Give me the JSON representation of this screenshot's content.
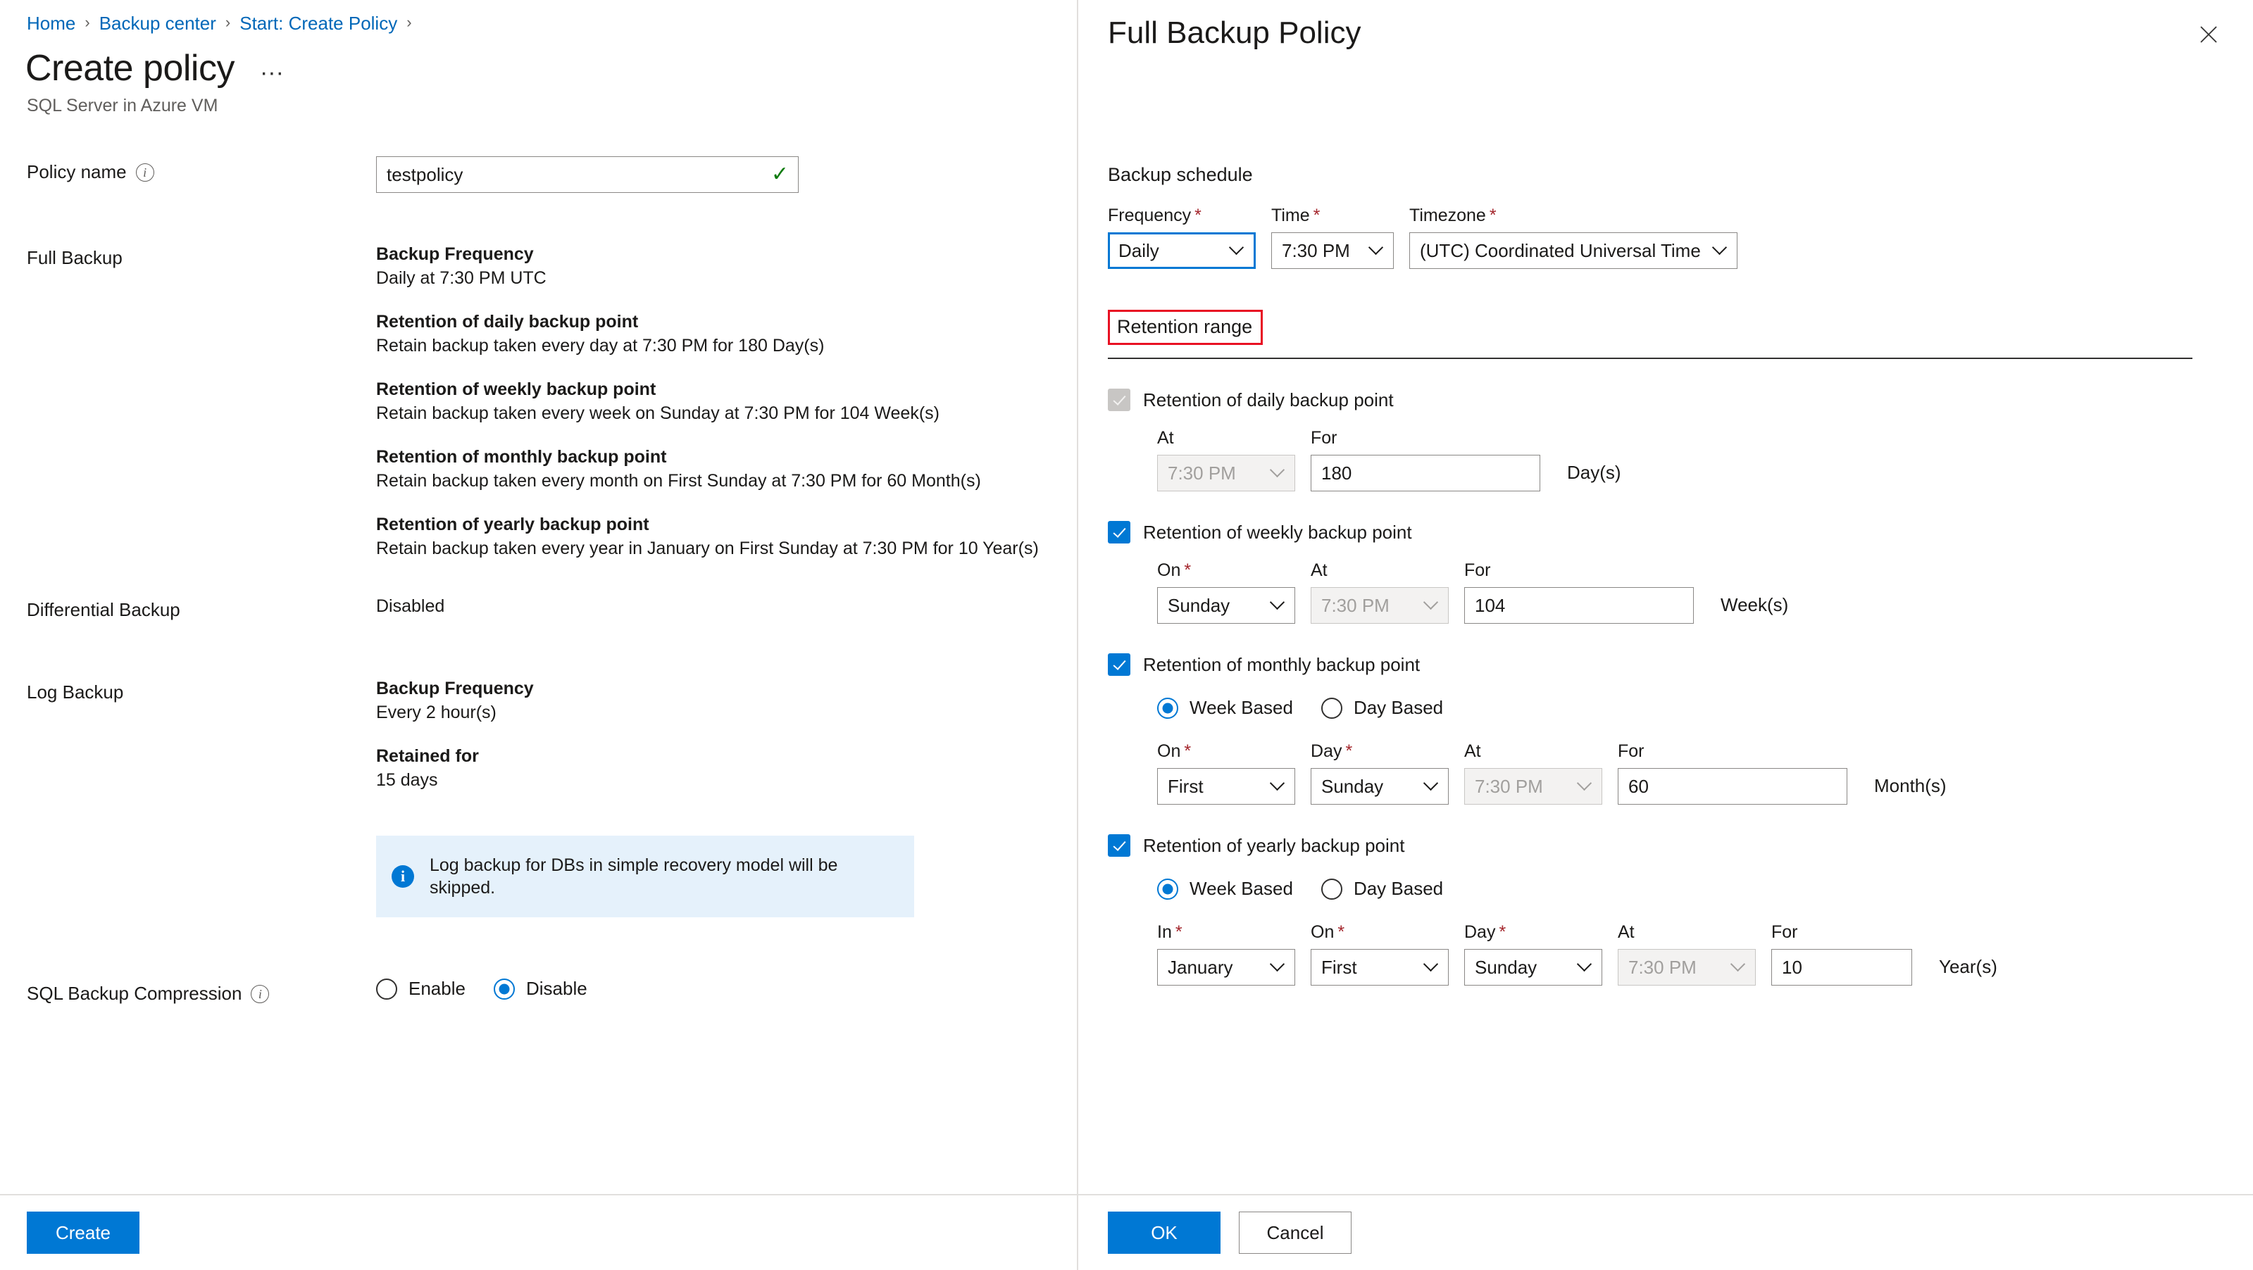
{
  "breadcrumb": {
    "items": [
      {
        "label": "Home",
        "separator": "›"
      },
      {
        "label": "Backup center",
        "separator": "›"
      },
      {
        "label": "Start: Create Policy",
        "separator": "›"
      }
    ]
  },
  "header": {
    "title": "Create policy",
    "subtitle": "SQL Server in Azure VM",
    "more_label": "···"
  },
  "left": {
    "policy_name": {
      "label": "Policy name",
      "info_glyph": "i",
      "value": "testpolicy",
      "placeholder": "",
      "valid_icon": "✓"
    },
    "full_backup": {
      "label": "Full Backup",
      "blocks": [
        {
          "head": "Backup Frequency",
          "sub": "Daily at 7:30 PM UTC"
        },
        {
          "head": "Retention of daily backup point",
          "sub": "Retain backup taken every day at 7:30 PM for 180 Day(s)"
        },
        {
          "head": "Retention of weekly backup point",
          "sub": "Retain backup taken every week on Sunday at 7:30 PM for 104 Week(s)"
        },
        {
          "head": "Retention of monthly backup point",
          "sub": "Retain backup taken every month on First Sunday at 7:30 PM for 60 Month(s)"
        },
        {
          "head": "Retention of yearly backup point",
          "sub": "Retain backup taken every year in January on First Sunday at 7:30 PM for 10 Year(s)"
        }
      ]
    },
    "differential_backup": {
      "label": "Differential Backup",
      "value": "Disabled"
    },
    "log_backup": {
      "label": "Log Backup",
      "blocks": [
        {
          "head": "Backup Frequency",
          "sub": "Every 2 hour(s)"
        },
        {
          "head": "Retained for",
          "sub": "15 days"
        }
      ],
      "banner": {
        "icon": "info-icon",
        "icon_glyph": "i",
        "text": "Log backup for DBs in simple recovery model will be skipped."
      }
    },
    "compression": {
      "label": "SQL Backup Compression",
      "info_glyph": "i",
      "options": [
        {
          "label": "Enable",
          "checked": false
        },
        {
          "label": "Disable",
          "checked": true
        }
      ]
    },
    "footer": {
      "create_label": "Create"
    }
  },
  "panel": {
    "title": "Full Backup Policy",
    "close_label": "✕",
    "backup_schedule": {
      "section_label": "Backup schedule",
      "frequency": {
        "label": "Frequency",
        "required": true,
        "value": "Daily",
        "focused": true
      },
      "time": {
        "label": "Time",
        "required": true,
        "value": "7:30 PM",
        "focused": false
      },
      "timezone": {
        "label": "Timezone",
        "required": true,
        "value": "(UTC) Coordinated Universal Time",
        "focused": false
      }
    },
    "retention_range": {
      "title": "Retention range",
      "highlight_color": "#e81123",
      "daily": {
        "checkbox_label": "Retention of daily backup point",
        "checked": true,
        "disabled": true,
        "at": {
          "label": "At",
          "required": false,
          "value": "7:30 PM",
          "disabled": true
        },
        "for": {
          "label": "For",
          "required": false,
          "value": "180",
          "unit": "Day(s)"
        }
      },
      "weekly": {
        "checkbox_label": "Retention of weekly backup point",
        "checked": true,
        "disabled": false,
        "on": {
          "label": "On",
          "required": true,
          "value": "Sunday"
        },
        "at": {
          "label": "At",
          "required": false,
          "value": "7:30 PM",
          "disabled": true
        },
        "for": {
          "label": "For",
          "required": false,
          "value": "104",
          "unit": "Week(s)"
        }
      },
      "monthly": {
        "checkbox_label": "Retention of monthly backup point",
        "checked": true,
        "disabled": false,
        "mode_options": [
          {
            "label": "Week Based",
            "checked": true
          },
          {
            "label": "Day Based",
            "checked": false
          }
        ],
        "on": {
          "label": "On",
          "required": true,
          "value": "First"
        },
        "day": {
          "label": "Day",
          "required": true,
          "value": "Sunday"
        },
        "at": {
          "label": "At",
          "required": false,
          "value": "7:30 PM",
          "disabled": true
        },
        "for": {
          "label": "For",
          "required": false,
          "value": "60",
          "unit": "Month(s)"
        }
      },
      "yearly": {
        "checkbox_label": "Retention of yearly backup point",
        "checked": true,
        "disabled": false,
        "mode_options": [
          {
            "label": "Week Based",
            "checked": true
          },
          {
            "label": "Day Based",
            "checked": false
          }
        ],
        "in": {
          "label": "In",
          "required": true,
          "value": "January"
        },
        "on": {
          "label": "On",
          "required": true,
          "value": "First"
        },
        "day": {
          "label": "Day",
          "required": true,
          "value": "Sunday"
        },
        "at": {
          "label": "At",
          "required": false,
          "value": "7:30 PM",
          "disabled": true
        },
        "for": {
          "label": "For",
          "required": false,
          "value": "10",
          "unit": "Year(s)"
        }
      }
    },
    "footer": {
      "ok_label": "OK",
      "cancel_label": "Cancel"
    }
  },
  "colors": {
    "accent": "#0078d4",
    "link": "#0067b8",
    "required": "#a4262c",
    "highlight": "#e81123",
    "success": "#107c10",
    "banner_bg": "#e5f1fb"
  }
}
